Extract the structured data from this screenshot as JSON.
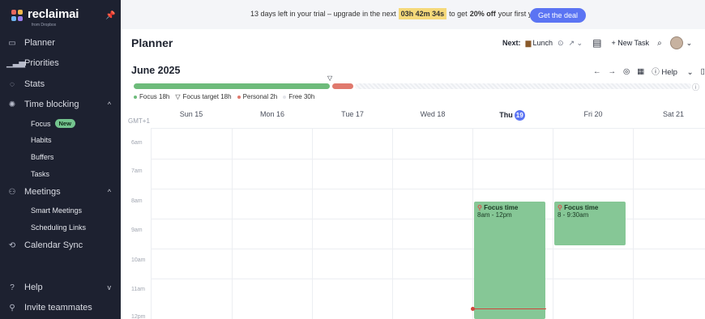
{
  "sidebar": {
    "logo_text": "reclaimai",
    "logo_sub": "from Dropbox",
    "items": [
      {
        "label": "Planner",
        "icon": "calendar-icon"
      },
      {
        "label": "Priorities",
        "icon": "bars-icon"
      },
      {
        "label": "Stats",
        "icon": "circle-icon"
      },
      {
        "label": "Time blocking",
        "icon": "sparkle-icon"
      },
      {
        "label": "Meetings",
        "icon": "people-icon"
      },
      {
        "label": "Calendar Sync",
        "icon": "sync-icon"
      },
      {
        "label": "Help",
        "icon": "question-icon"
      },
      {
        "label": "Invite teammates",
        "icon": "add-user-icon"
      }
    ],
    "time_blocking_sub": [
      "Focus",
      "Habits",
      "Buffers",
      "Tasks"
    ],
    "focus_badge": "New",
    "meetings_sub": [
      "Smart Meetings",
      "Scheduling Links"
    ]
  },
  "banner": {
    "prefix": "13 days left in your trial – upgrade in the next",
    "timer": "03h 42m 34s",
    "mid": "to get",
    "bold": "20% off",
    "suffix": "your first year",
    "deal_button": "Get the deal"
  },
  "header": {
    "title": "Planner",
    "next_label": "Next:",
    "next_event": "Lunch",
    "new_task": "+ New Task",
    "help": "Help"
  },
  "calendar": {
    "month": "June 2025",
    "timezone": "GMT+1",
    "legend": [
      {
        "label": "Focus 18h",
        "color": "#6dbb7a"
      },
      {
        "label": "Focus target 18h",
        "color": "#1f2430"
      },
      {
        "label": "Personal 2h",
        "color": "#e0796d"
      },
      {
        "label": "Free 30h",
        "color": "#e3e5ea"
      }
    ],
    "days": [
      "Sun 15",
      "Mon 16",
      "Tue 17",
      "Wed 18",
      "Thu",
      "Fri 20",
      "Sat 21"
    ],
    "today_num": "19",
    "hours": [
      "6am",
      "7am",
      "8am",
      "9am",
      "10am",
      "11am",
      "12pm"
    ],
    "events": [
      {
        "title": "Focus time",
        "time": "8am - 12pm"
      },
      {
        "title": "Focus time",
        "time": "8 - 9:30am"
      }
    ]
  },
  "colors": {
    "accent": "#5b74f3",
    "focus": "#86c796",
    "sidebar": "#1d2130"
  }
}
